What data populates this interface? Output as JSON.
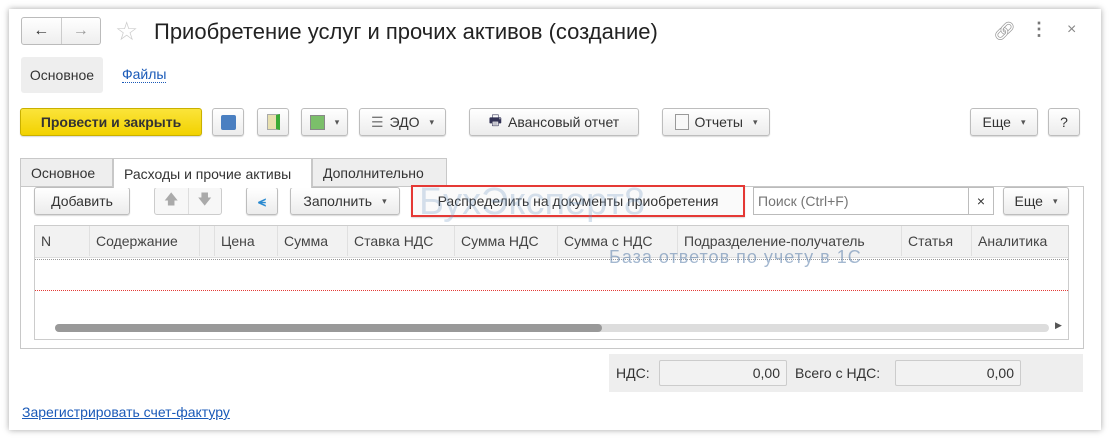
{
  "title": "Приобретение услуг и прочих активов (создание)",
  "nav_tabs": [
    {
      "label": "Основное"
    },
    {
      "label": "Файлы"
    }
  ],
  "toolbar": {
    "post_close": "Провести и закрыть",
    "edo": "ЭДО",
    "advance_report": "Авансовый отчет",
    "reports": "Отчеты",
    "more": "Еще",
    "help": "?"
  },
  "form_tabs": [
    {
      "label": "Основное"
    },
    {
      "label": "Расходы и прочие активы"
    },
    {
      "label": "Дополнительно"
    }
  ],
  "table_toolbar": {
    "add": "Добавить",
    "fill": "Заполнить",
    "distribute": "Распределить на документы приобретения",
    "search_placeholder": "Поиск (Ctrl+F)",
    "clear": "×",
    "more": "Еще"
  },
  "columns": [
    "N",
    "Содержание",
    "",
    "Цена",
    "Сумма",
    "Ставка НДС",
    "Сумма НДС",
    "Сумма с НДС",
    "Подразделение-получатель",
    "Статья",
    "Аналитика"
  ],
  "totals": {
    "vat_label": "НДС:",
    "vat_value": "0,00",
    "total_label": "Всего с НДС:",
    "total_value": "0,00"
  },
  "register_invoice_link": "Зарегистрировать счет-фактуру",
  "watermark": {
    "brand": "БухЭксперт8",
    "tagline": "База ответов по учету в 1С"
  },
  "colors": {
    "primary_button": "#f5d800",
    "highlight": "#e53935",
    "link": "#1a5ab8"
  }
}
